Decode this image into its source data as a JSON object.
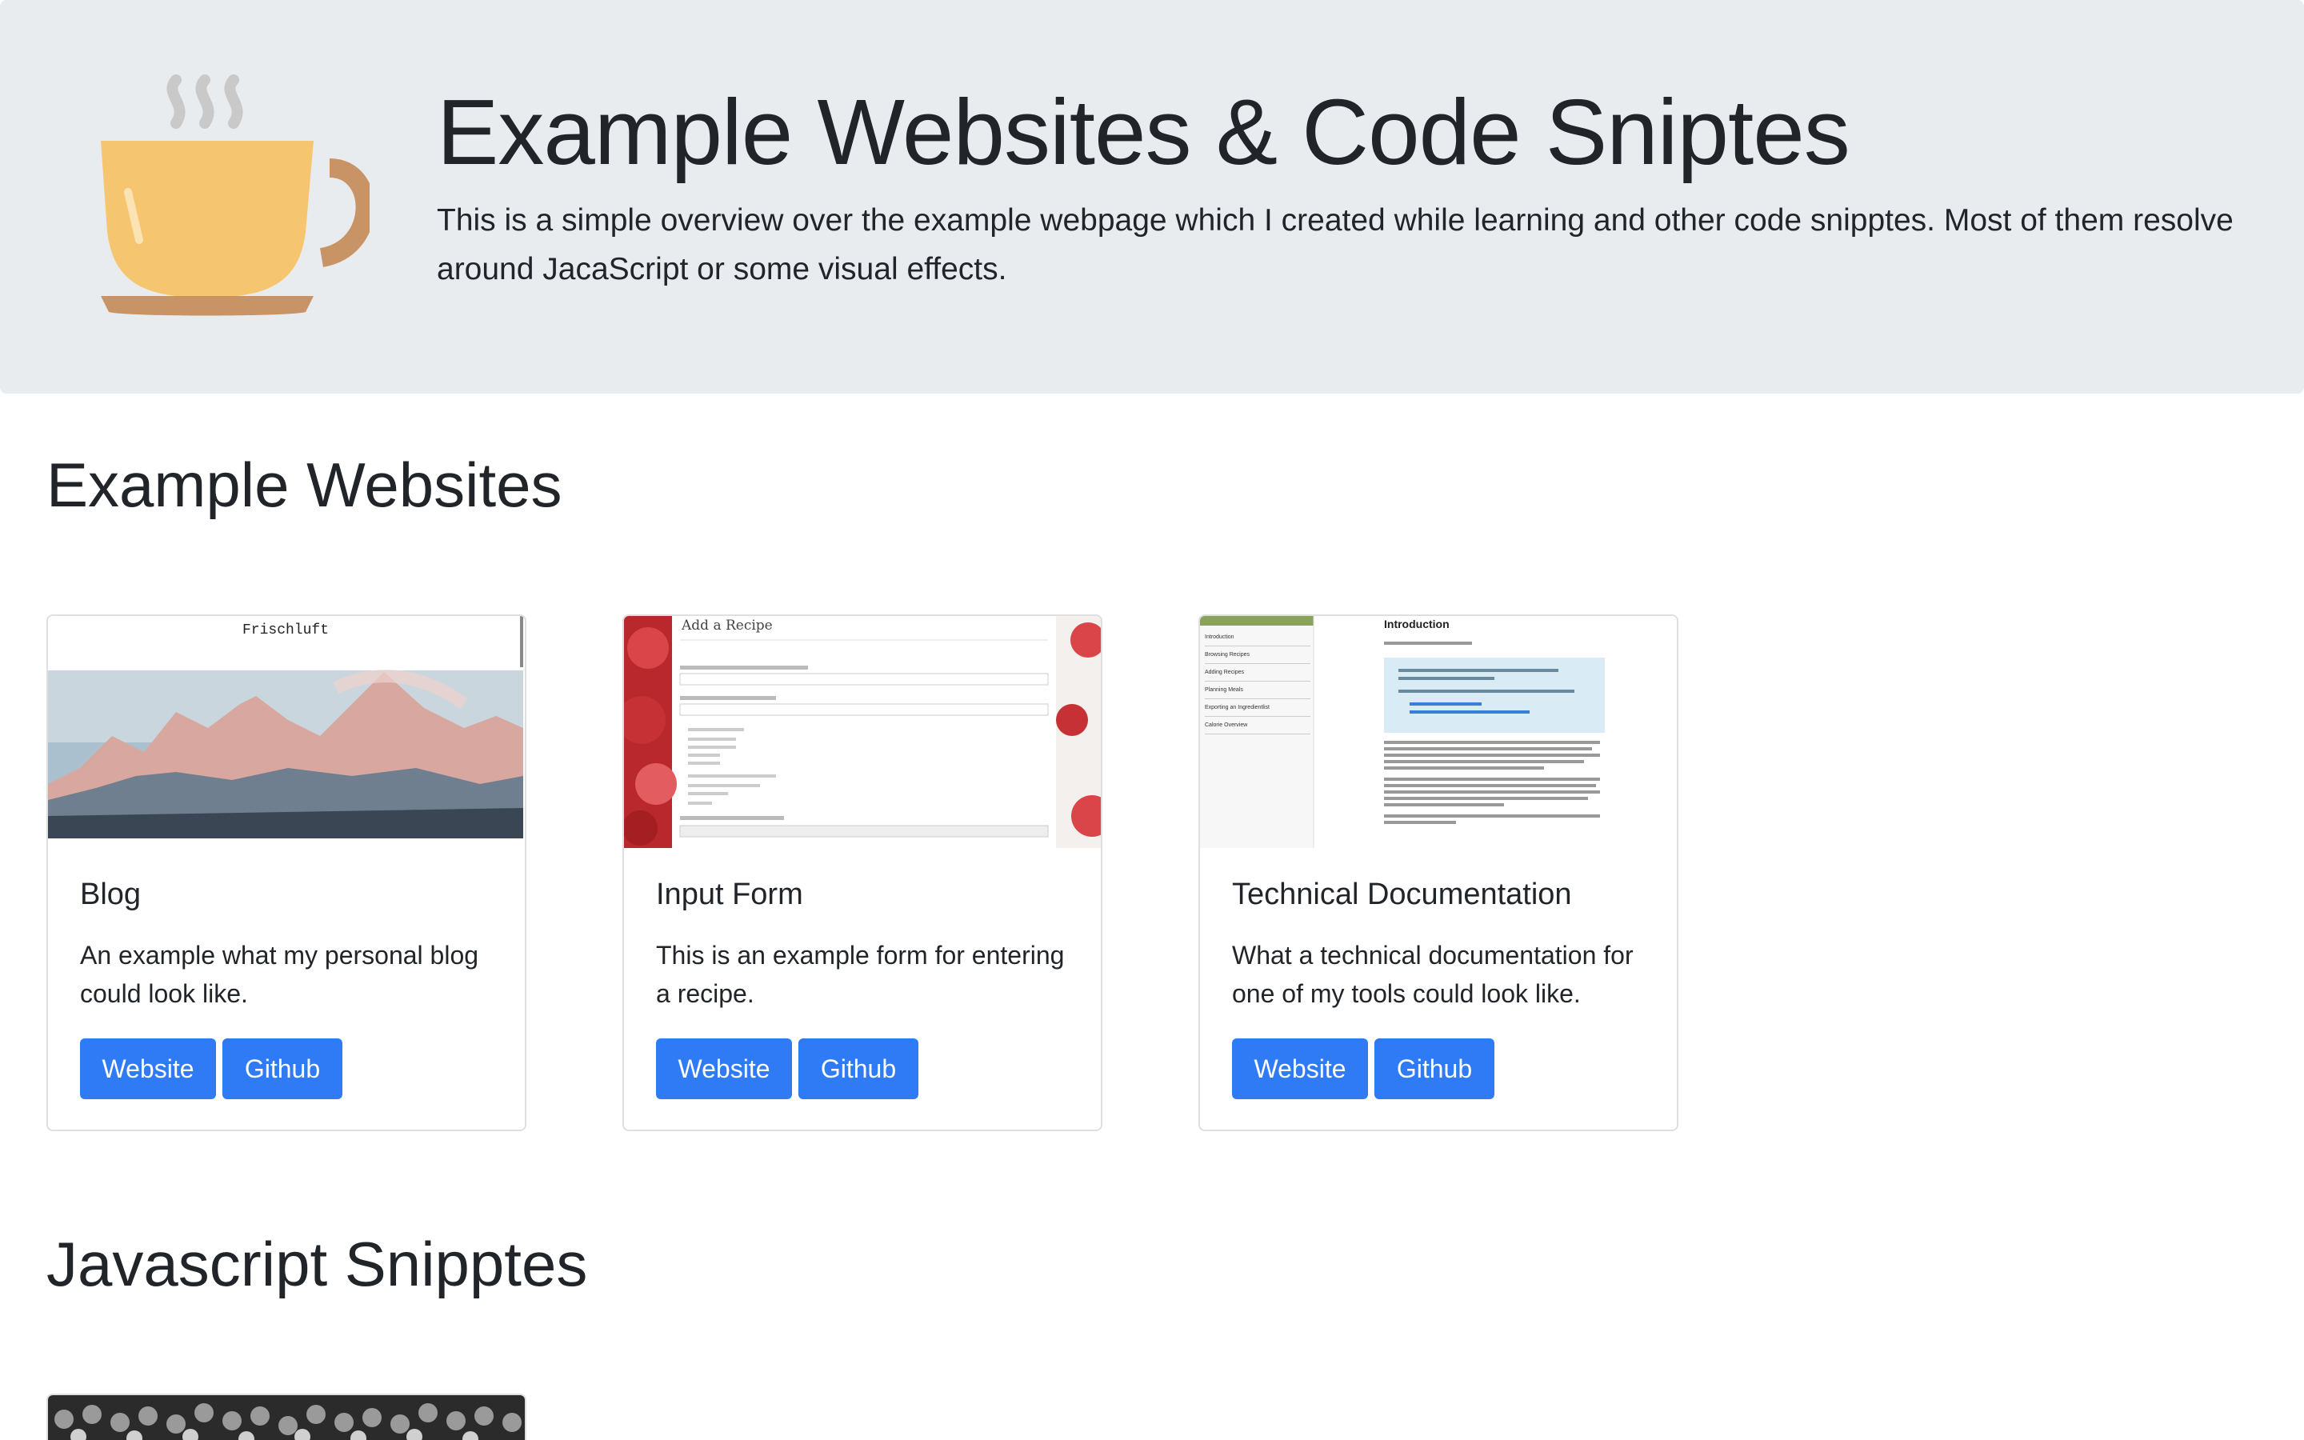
{
  "header": {
    "logo_icon": "coffee-cup-icon",
    "title": "Example Websites & Code Sniptes",
    "lead": "This is a simple overview over the example webpage which I created while learning and other code snipptes. Most of them resolve around JacaScript or some visual effects."
  },
  "sections": {
    "websites_title": "Example Websites",
    "snippets_title": "Javascript Snipptes"
  },
  "cards": [
    {
      "title": "Blog",
      "text": "An example what my personal blog could look like.",
      "website_label": "Website",
      "github_label": "Github",
      "preview": {
        "heading": "Frischluft"
      }
    },
    {
      "title": "Input Form",
      "text": "This is an example form for entering a recipe.",
      "website_label": "Website",
      "github_label": "Github",
      "preview": {
        "heading": "Add a Recipe"
      }
    },
    {
      "title": "Technical Documentation",
      "text": "What a technical documentation for one of my tools could look like.",
      "website_label": "Website",
      "github_label": "Github",
      "preview": {
        "heading": "Introduction",
        "nav": [
          "Introduction",
          "Browsing Recipes",
          "Adding Recipes",
          "Planning Meals",
          "Exporting an Ingredientlist",
          "Calorie Overview"
        ]
      }
    }
  ],
  "colors": {
    "primary": "#2f7bf5",
    "jumbotron_bg": "#e9ecef",
    "cup": "#f6c570",
    "saucer": "#c89466",
    "doc_accent": "#8aa35c"
  }
}
